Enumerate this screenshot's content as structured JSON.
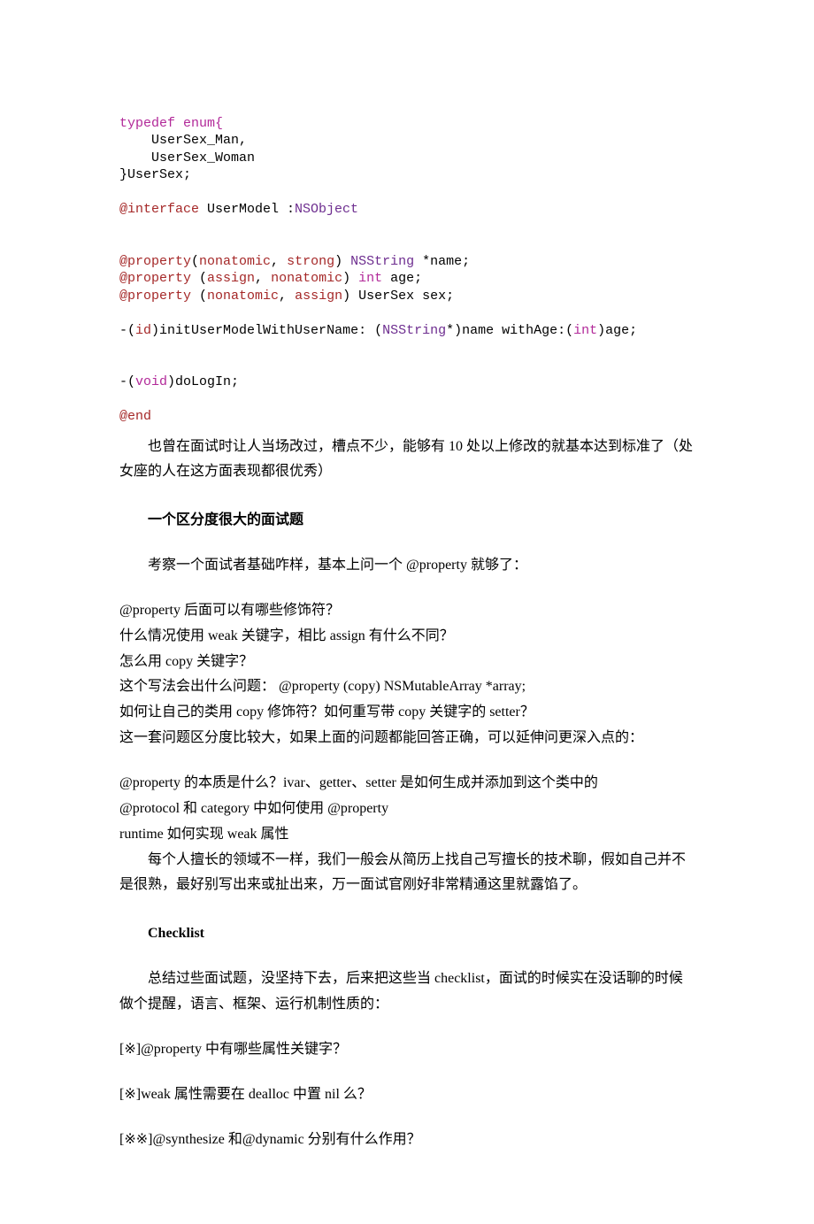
{
  "code": {
    "l1": "typedef enum{",
    "l2": "    UserSex_Man,",
    "l3": "    UserSex_Woman",
    "l4": "}UserSex;",
    "l5a": "@interface",
    "l5b": " UserModel :",
    "l5c": "NSObject",
    "l6a": "@property",
    "l6b": "(",
    "l6c": "nonatomic",
    "l6d": ", ",
    "l6e": "strong",
    "l6f": ") ",
    "l6g": "NSString",
    "l6h": " *name;",
    "l7a": "@property",
    "l7b": " (",
    "l7c": "assign",
    "l7d": ", ",
    "l7e": "nonatomic",
    "l7f": ") ",
    "l7g": "int",
    "l7h": " age;",
    "l8a": "@property",
    "l8b": " (",
    "l8c": "nonatomic",
    "l8d": ", ",
    "l8e": "assign",
    "l8f": ") UserSex sex;",
    "l9a": "-(",
    "l9b": "id",
    "l9c": ")initUserModelWithUserName: (",
    "l9d": "NSString",
    "l9e": "*)name withAge:(",
    "l9f": "int",
    "l9g": ")age;",
    "l10a": "-(",
    "l10b": "void",
    "l10c": ")doLogIn;",
    "l11": "@end"
  },
  "p1": "　　也曾在面试时让人当场改过，槽点不少，能够有 10 处以上修改的就基本达到标准了（处女座的人在这方面表现都很优秀）",
  "h1": "一个区分度很大的面试题",
  "p2": "考察一个面试者基础咋样，基本上问一个 @property 就够了：",
  "q1": "@property 后面可以有哪些修饰符？",
  "q2": "什么情况使用 weak 关键字，相比 assign 有什么不同？",
  "q3": "怎么用 copy 关键字？",
  "q4": "这个写法会出什么问题： @property (copy) NSMutableArray *array;",
  "q5": "如何让自己的类用 copy 修饰符？如何重写带 copy 关键字的 setter？",
  "q6": "这一套问题区分度比较大，如果上面的问题都能回答正确，可以延伸问更深入点的：",
  "q7": "@property 的本质是什么？ivar、getter、setter 是如何生成并添加到这个类中的",
  "q8": "@protocol 和 category 中如何使用 @property",
  "q9": "runtime 如何实现 weak 属性",
  "p3": "　　每个人擅长的领域不一样，我们一般会从简历上找自己写擅长的技术聊，假如自己并不是很熟，最好别写出来或扯出来，万一面试官刚好非常精通这里就露馅了。",
  "h2": "Checklist",
  "p4": "总结过些面试题，没坚持下去，后来把这些当 checklist，面试的时候实在没话聊的时候做个提醒，语言、框架、运行机制性质的：",
  "c1": "[※]@property 中有哪些属性关键字？",
  "c2": "[※]weak 属性需要在 dealloc 中置 nil 么？",
  "c3": "[※※]@synthesize 和@dynamic 分别有什么作用？"
}
